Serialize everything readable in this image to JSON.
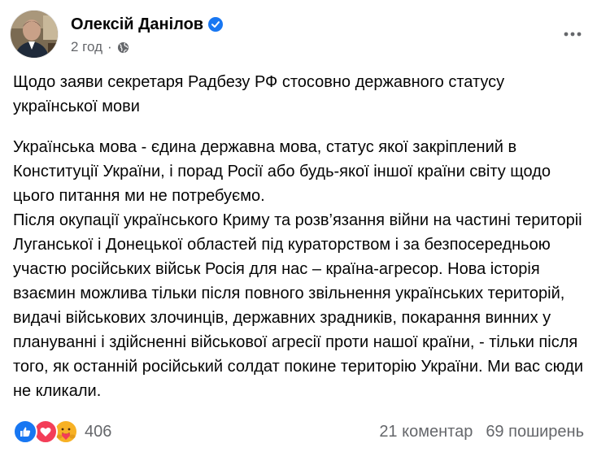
{
  "post": {
    "author": "Олексій Данілов",
    "time": "2 год",
    "separator": "·",
    "title": "Щодо заяви секретаря Радбезу РФ стосовно державного статусу української мови",
    "body": "Українська мова - єдина державна мова, статус якої закріплений в Конституції України, і порад Росії або будь-якої іншої  країни світу щодо цього питання ми не потребуємо.\nПісля окупації українського Криму та розв’язання війни на частині територіі Луганської і Донецької областей під кураторством і за безпосередньою участю російських військ Росія для нас – країна-агресор. Нова історія взаємин можлива тільки після повного звільнення українських територій, видачі військових злочинців, державних зрадників, покарання винних у плануванні і здійсненні військової агресії проти нашої країни, - тільки після того, як останній російський солдат покине територію України. Ми вас сюди не кликали."
  },
  "footer": {
    "reaction_count": "406",
    "comments": "21 коментар",
    "shares": "69 поширень"
  },
  "icons": {
    "verified": "verified-badge-icon",
    "audience": "globe-icon",
    "more": "more-options-icon",
    "reactions": [
      "like-icon",
      "love-icon",
      "care-icon"
    ]
  },
  "colors": {
    "text": "#050505",
    "secondary": "#65676b",
    "verified": "#1877f2",
    "like": "#1877f2",
    "love": "#f33e58",
    "care": "#f7b125"
  }
}
